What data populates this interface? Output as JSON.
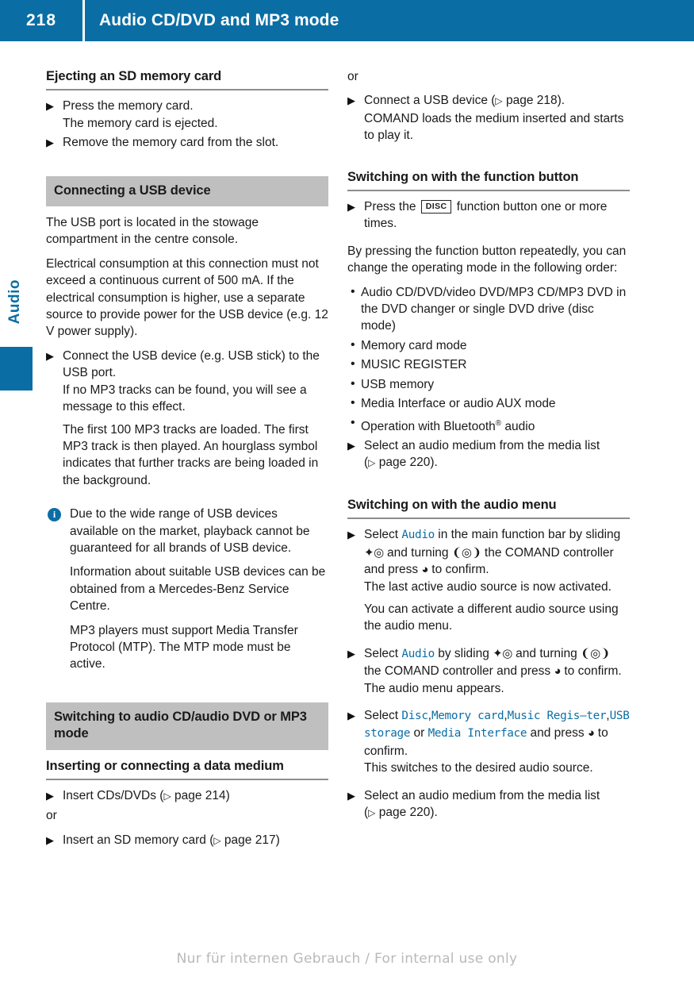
{
  "header": {
    "page_number": "218",
    "title": "Audio CD/DVD and MP3 mode"
  },
  "side_tab": {
    "label": "Audio"
  },
  "footer": {
    "text": "Nur für internen Gebrauch / For internal use only"
  },
  "left_column": {
    "heading_eject": "Ejecting an SD memory card",
    "step_press_card": "Press the memory card.",
    "step_press_card_result": "The memory card is ejected.",
    "step_remove_card": "Remove the memory card from the slot.",
    "heading_usb": "Connecting a USB device",
    "para_usb_port": "The USB port is located in the stowage compartment in the centre console.",
    "para_electrical": "Electrical consumption at this connection must not exceed a continuous current of 500 mA. If the electrical consumption is higher, use a separate source to provide power for the USB device (e.g. 12 V power supply).",
    "step_connect_usb": "Connect the USB device (e.g. USB stick) to the USB port.",
    "step_connect_usb_sub1": "If no MP3 tracks can be found, you will see a message to this effect.",
    "step_connect_usb_sub2": "The first 100 MP3 tracks are loaded. The first MP3 track is then played. An hourglass symbol indicates that further tracks are being loaded in the background.",
    "note_icon_glyph": "i",
    "note_wide_range": "Due to the wide range of USB devices available on the market, playback cannot be guaranteed for all brands of USB device.",
    "note_information": "Information about suitable USB devices can be obtained from a Mercedes-Benz Service Centre.",
    "note_mtp": "MP3 players must support Media Transfer Protocol (MTP). The MTP mode must be active.",
    "heading_switching": "Switching to audio CD/audio DVD or MP3 mode",
    "heading_inserting": "Inserting or connecting a data medium",
    "step_insert_cds": "Insert CDs/DVDs",
    "step_insert_cds_ref": "page 214",
    "or_text": "or",
    "step_insert_sd": "Insert an SD memory card",
    "step_insert_sd_ref": "page 217"
  },
  "right_column": {
    "or_text": "or",
    "step_connect_usb": "Connect a USB device",
    "step_connect_usb_ref": "page 218",
    "step_connect_usb_sub": "COMAND loads the medium inserted and starts to play it.",
    "heading_function_button": "Switching on with the function button",
    "step_press_disc_pre": "Press the",
    "step_press_disc_key": "DISC",
    "step_press_disc_post": "function button one or more times.",
    "para_by_pressing": "By pressing the function button repeatedly, you can change the operating mode in the following order:",
    "modes": [
      "Audio CD/DVD/video DVD/MP3 CD/MP3 DVD in the DVD changer or single DVD drive (disc mode)",
      "Memory card mode",
      "MUSIC REGISTER",
      "USB memory",
      "Media Interface or audio AUX mode"
    ],
    "mode_bluetooth_pre": "Operation with Bluetooth",
    "mode_bluetooth_sup": "®",
    "mode_bluetooth_post": " audio",
    "step_select_medium": "Select an audio medium from the media list",
    "step_select_medium_ref": "page 220",
    "heading_audio_menu": "Switching on with the audio menu",
    "step_select_audio_1_pre": "Select ",
    "step_select_audio_1_cmd": "Audio",
    "step_select_audio_1_mid": " in the main function bar by sliding ",
    "step_select_audio_1_sym_slide": "✦◎",
    "step_select_audio_1_mid2": " and turning ",
    "step_select_audio_1_sym_turn": "❨◎❩",
    "step_select_audio_1_mid3": " the COMAND controller and press ",
    "step_select_audio_1_sym_press": "◕",
    "step_select_audio_1_end": " to confirm.",
    "step_select_audio_1_sub1": "The last active audio source is now activated.",
    "step_select_audio_1_sub2": "You can activate a different audio source using the audio menu.",
    "step_select_audio_2_pre": "Select ",
    "step_select_audio_2_cmd": "Audio",
    "step_select_audio_2_mid": " by sliding ",
    "step_select_audio_2_mid2": " and turning ",
    "step_select_audio_2_mid3": " the COMAND controller and press ",
    "step_select_audio_2_end": " to confirm.",
    "step_select_audio_2_sub": "The audio menu appears.",
    "step_select_source_pre": "Select ",
    "source_disc": "Disc",
    "source_memory_card": "Memory card",
    "source_music_register": "Music Regis—ter",
    "source_usb_storage": "USB storage",
    "source_media_interface": "Media Interface",
    "step_select_source_or": " or ",
    "step_select_source_post": "and press ",
    "step_select_source_end": " to confirm.",
    "step_select_source_sub": "This switches to the desired audio source.",
    "step_select_medium_2": "Select an audio medium from the media list",
    "step_select_medium_2_ref": "page 220"
  },
  "colors": {
    "brand_blue": "#0a6ea5",
    "heading_grey": "#bfbfbf",
    "rule_grey": "#8d8d8d"
  }
}
